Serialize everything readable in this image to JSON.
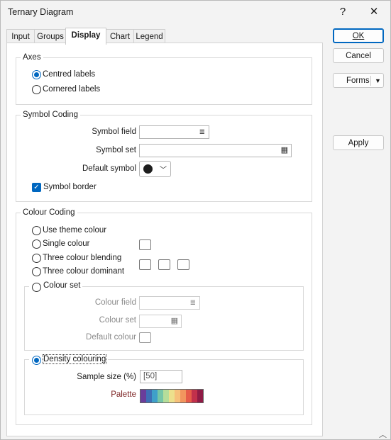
{
  "window": {
    "title": "Ternary Diagram",
    "help": "?",
    "close": "✕"
  },
  "tabs": [
    "Input",
    "Groups",
    "Display",
    "Chart",
    "Legend"
  ],
  "buttons": {
    "ok": "OK",
    "cancel": "Cancel",
    "forms": "Forms",
    "apply": "Apply"
  },
  "axes": {
    "title": "Axes",
    "centred": "Centred labels",
    "cornered": "Cornered labels"
  },
  "symbol": {
    "title": "Symbol Coding",
    "field_label": "Symbol field",
    "set_label": "Symbol set",
    "default_label": "Default symbol",
    "border_label": "Symbol border"
  },
  "colour": {
    "title": "Colour Coding",
    "use_theme": "Use theme colour",
    "single": "Single colour",
    "three_blend": "Three colour blending",
    "three_dominant": "Three colour dominant",
    "colour_set": "Colour set",
    "colour_field_label": "Colour field",
    "colour_set_label": "Colour set",
    "default_colour_label": "Default colour",
    "density": "Density colouring",
    "sample_size_label": "Sample size (%)",
    "sample_size_value": "[50]",
    "palette_label": "Palette",
    "palette_colors": [
      "#6a3d9a",
      "#3f6fb5",
      "#3fa0c9",
      "#76c6a7",
      "#b5dd9a",
      "#ece08c",
      "#f6c07a",
      "#f2955e",
      "#e65b49",
      "#c2304b",
      "#8f1b45"
    ]
  },
  "colors": {
    "accent": "#0067c0",
    "palette_label_color": "#7a1f1f"
  }
}
